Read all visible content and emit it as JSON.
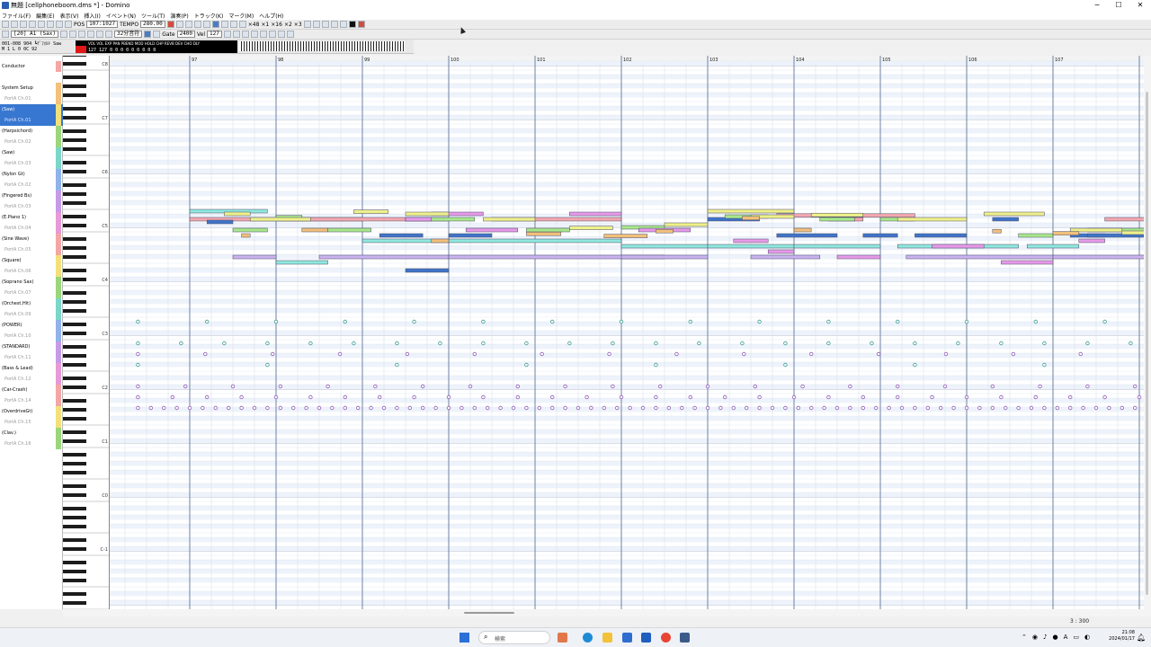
{
  "window": {
    "title": "無題 [cellphoneboom.dms *] - Domino",
    "min": "─",
    "max": "☐",
    "close": "✕"
  },
  "menu": [
    "ファイル(F)",
    "編集(E)",
    "表示(V)",
    "挿入(I)",
    "イベント(N)",
    "ツール(T)",
    "演奏(P)",
    "トラック(K)",
    "マーク(M)",
    "ヘルプ(H)"
  ],
  "toolbar1": {
    "position": "107:1027",
    "tempo_label": "TEMPO",
    "tempo": "280.00",
    "counters": [
      "×48",
      "×1",
      "×16",
      "×2",
      "×3"
    ]
  },
  "toolbar2": {
    "track_select": "[20] A1  (Sax)",
    "note_length": "32分音符",
    "gate_label": "Gate",
    "gate": "2400",
    "vel_label": "Vel",
    "vel": "127"
  },
  "status": {
    "line1": "001-008 904 ┗ﾃﾞﾌｫﾙﾄ Saw",
    "line2": "M  1  L   0  0C  92",
    "meter_headers": "VOL VOL EXP PAN PBEND MOD HOLD CHP REVB DEV CHO DLY",
    "meter_values": "127 127  0   0   0   0   0   0   0   0   0"
  },
  "tracks": [
    {
      "name": "Conductor",
      "port": "",
      "color": "#f4a6a6"
    },
    {
      "name": "System Setup",
      "port": "PortA  Ch.01",
      "color": "#f4c07a"
    },
    {
      "name": "(Saw)",
      "port": "PortA  Ch.01",
      "color": "#f3e07a",
      "selected": true
    },
    {
      "name": "(Harpsichord)",
      "port": "PortA  Ch.02",
      "color": "#9ad77a"
    },
    {
      "name": "(Saw)",
      "port": "PortA  Ch.03",
      "color": "#7ad7c9"
    },
    {
      "name": "(Nylon Gt)",
      "port": "PortA  Ch.02",
      "color": "#8fb3ea"
    },
    {
      "name": "(Fingered Bs)",
      "port": "PortA  Ch.03",
      "color": "#c79ae6"
    },
    {
      "name": "(E.Piano 1)",
      "port": "PortA  Ch.04",
      "color": "#e69ad7"
    },
    {
      "name": "(Sine Wave)",
      "port": "PortA  Ch.05",
      "color": "#f4a6a6"
    },
    {
      "name": "(Square)",
      "port": "PortA  Ch.06",
      "color": "#f3e07a"
    },
    {
      "name": "(Soprano Sax)",
      "port": "PortA  Ch.07",
      "color": "#9ad77a"
    },
    {
      "name": "(Orchest.Hit)",
      "port": "PortA  Ch.09",
      "color": "#7ad7c9"
    },
    {
      "name": "(POWER)",
      "port": "PortA  Ch.10",
      "color": "#8fb3ea"
    },
    {
      "name": "(STANDARD)",
      "port": "PortA  Ch.11",
      "color": "#c79ae6"
    },
    {
      "name": "(Bass & Lead)",
      "port": "PortA  Ch.12",
      "color": "#e69ad7"
    },
    {
      "name": "(Car-Crash)",
      "port": "PortA  Ch.14",
      "color": "#f4a6a6"
    },
    {
      "name": "(OverdriveGt)",
      "port": "PortA  Ch.15",
      "color": "#f3e07a"
    },
    {
      "name": "(Clav.)",
      "port": "PortA  Ch.16",
      "color": "#9ad77a"
    }
  ],
  "measures": [
    "97",
    "98",
    "99",
    "100",
    "101",
    "102",
    "103",
    "104",
    "105",
    "106",
    "107"
  ],
  "octaves": [
    "C8",
    "C7",
    "C6",
    "C5",
    "C4",
    "C3",
    "C2",
    "C1",
    "C0",
    "C-1"
  ],
  "note_colors": {
    "red": "#f2a8ae",
    "blue": "#3f74c8",
    "green": "#a8e88a",
    "lav": "#cbb3ef",
    "cyan": "#8fe8dc",
    "mag": "#e69ae8",
    "yel": "#eef08a",
    "orange": "#f1c07a"
  },
  "notes": [
    [
      "red",
      0,
      2,
      7
    ],
    [
      "red",
      1,
      3,
      7
    ],
    [
      "red",
      3.5,
      5,
      7
    ],
    [
      "red",
      6.8,
      8.4,
      6.3
    ],
    [
      "red",
      7.4,
      7.8,
      7
    ],
    [
      "red",
      10.6,
      11.6,
      7
    ],
    [
      "blue",
      0.2,
      0.5,
      7.5
    ],
    [
      "blue",
      2.2,
      2.7,
      10
    ],
    [
      "blue",
      2.5,
      3,
      16.5
    ],
    [
      "blue",
      3,
      3.5,
      10
    ],
    [
      "blue",
      6,
      6.6,
      7
    ],
    [
      "blue",
      6.8,
      7.5,
      10
    ],
    [
      "blue",
      7.8,
      8.2,
      10
    ],
    [
      "blue",
      8.4,
      9,
      10
    ],
    [
      "blue",
      9.3,
      9.6,
      7
    ],
    [
      "blue",
      10.2,
      10.6,
      10
    ],
    [
      "blue",
      10.4,
      11.3,
      10
    ],
    [
      "green",
      0.5,
      0.9,
      9
    ],
    [
      "green",
      1,
      1.3,
      6.6
    ],
    [
      "green",
      1.6,
      2.1,
      9
    ],
    [
      "green",
      2.5,
      3.3,
      7
    ],
    [
      "green",
      3.9,
      4.4,
      9
    ],
    [
      "green",
      5,
      5.5,
      8.5
    ],
    [
      "green",
      6.2,
      6.7,
      6.5
    ],
    [
      "green",
      7.3,
      7.7,
      7
    ],
    [
      "green",
      8,
      8.4,
      7
    ],
    [
      "green",
      9.6,
      10,
      10
    ],
    [
      "green",
      10.4,
      11.1,
      9
    ],
    [
      "lav",
      0.5,
      1,
      14
    ],
    [
      "lav",
      1.5,
      3,
      14
    ],
    [
      "lav",
      3,
      5.5,
      14
    ],
    [
      "lav",
      5,
      6,
      14
    ],
    [
      "lav",
      6.5,
      7.3,
      14
    ],
    [
      "lav",
      8.3,
      10,
      14
    ],
    [
      "lav",
      10,
      11.4,
      14
    ],
    [
      "cyan",
      0,
      0.9,
      5.5
    ],
    [
      "cyan",
      1,
      1.6,
      15
    ],
    [
      "cyan",
      2,
      3,
      11
    ],
    [
      "cyan",
      3,
      5,
      11
    ],
    [
      "cyan",
      5,
      6,
      12
    ],
    [
      "cyan",
      6,
      7,
      12
    ],
    [
      "cyan",
      7,
      8,
      12
    ],
    [
      "cyan",
      8.2,
      9.6,
      12
    ],
    [
      "cyan",
      9.7,
      10.3,
      12
    ],
    [
      "mag",
      2.5,
      2.8,
      7
    ],
    [
      "mag",
      2.8,
      3.4,
      6
    ],
    [
      "mag",
      3.2,
      3.8,
      9
    ],
    [
      "mag",
      4.4,
      5,
      6
    ],
    [
      "mag",
      5.2,
      5.8,
      9
    ],
    [
      "mag",
      6.3,
      6.7,
      11
    ],
    [
      "mag",
      6.7,
      7,
      13
    ],
    [
      "mag",
      7.5,
      8,
      14
    ],
    [
      "mag",
      8.6,
      9.2,
      12
    ],
    [
      "mag",
      9.4,
      10,
      15
    ],
    [
      "mag",
      10.3,
      10.6,
      11
    ],
    [
      "yel",
      0.4,
      0.7,
      6
    ],
    [
      "yel",
      0.7,
      1.4,
      7
    ],
    [
      "yel",
      1.9,
      2.3,
      5.6
    ],
    [
      "yel",
      2.5,
      3,
      6
    ],
    [
      "yel",
      3.4,
      4,
      7
    ],
    [
      "yel",
      4.4,
      4.9,
      8.6
    ],
    [
      "yel",
      5.5,
      6,
      8
    ],
    [
      "yel",
      6,
      7,
      5.5
    ],
    [
      "yel",
      6.5,
      7,
      6.5
    ],
    [
      "yel",
      7.2,
      7.8,
      6.2
    ],
    [
      "yel",
      8.2,
      9,
      7
    ],
    [
      "yel",
      9.2,
      9.9,
      6
    ],
    [
      "yel",
      10.2,
      10.8,
      9
    ],
    [
      "yel",
      10.8,
      11.2,
      9.5
    ],
    [
      "orange",
      0.6,
      0.7,
      10
    ],
    [
      "orange",
      1.3,
      1.6,
      9
    ],
    [
      "orange",
      2.8,
      3,
      11
    ],
    [
      "orange",
      3.9,
      4.3,
      9.7
    ],
    [
      "orange",
      4.8,
      5.3,
      10.1
    ],
    [
      "orange",
      5.4,
      5.6,
      9.2
    ],
    [
      "orange",
      6.4,
      6.6,
      6.8
    ],
    [
      "orange",
      7,
      7.2,
      9
    ],
    [
      "orange",
      9.3,
      9.4,
      9.2
    ],
    [
      "orange",
      10,
      10.3,
      9.6
    ]
  ],
  "dots": [
    [
      "lav",
      0.78,
      3,
      32
    ],
    [
      "lav",
      0.55,
      3,
      38
    ],
    [
      "cyan",
      0.8,
      3,
      26
    ],
    [
      "cyan",
      0.5,
      3,
      30
    ],
    [
      "cyan",
      1.5,
      3,
      34
    ],
    [
      "mag",
      0.4,
      10.5,
      40
    ],
    [
      "mag",
      0.15,
      10.7,
      42
    ]
  ],
  "position_readout": "3 : 300",
  "taskbar": {
    "search_placeholder": "検索",
    "time": "21:08",
    "date": "2024/01/17"
  }
}
